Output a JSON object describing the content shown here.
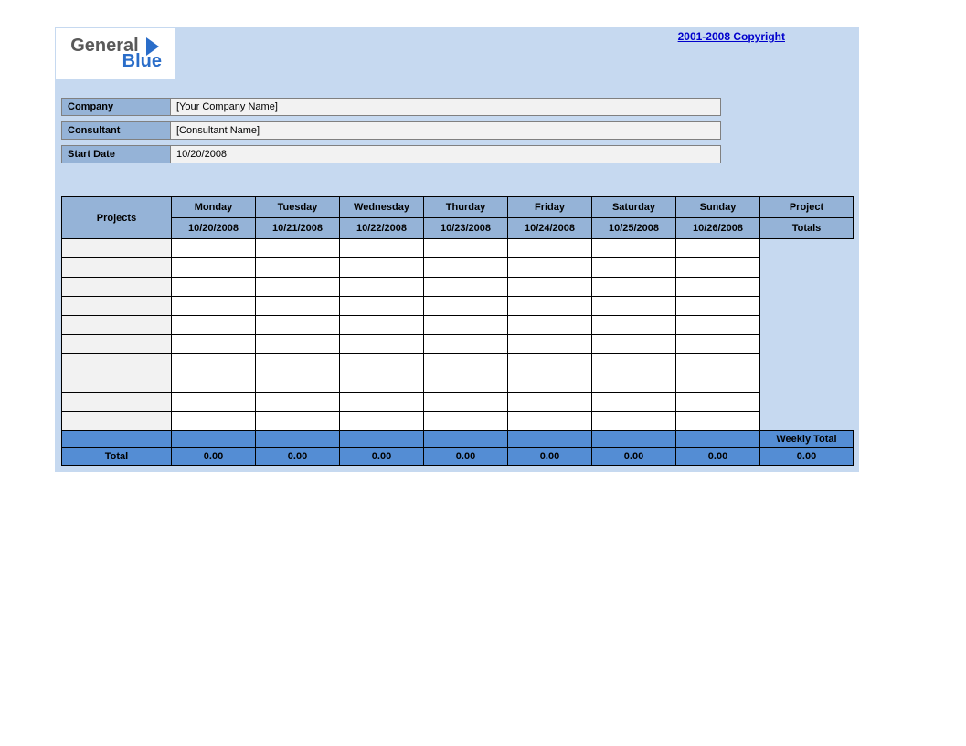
{
  "logo": {
    "line1": "General",
    "line2": "Blue"
  },
  "copyright": "2001-2008 Copyright",
  "info": {
    "company_label": "Company",
    "company_value": "[Your Company Name]",
    "consultant_label": "Consultant",
    "consultant_value": "[Consultant Name]",
    "start_date_label": "Start Date",
    "start_date_value": "10/20/2008"
  },
  "headers": {
    "projects": "Projects",
    "days": [
      {
        "name": "Monday",
        "date": "10/20/2008"
      },
      {
        "name": "Tuesday",
        "date": "10/21/2008"
      },
      {
        "name": "Wednesday",
        "date": "10/22/2008"
      },
      {
        "name": "Thurday",
        "date": "10/23/2008"
      },
      {
        "name": "Friday",
        "date": "10/24/2008"
      },
      {
        "name": "Saturday",
        "date": "10/25/2008"
      },
      {
        "name": "Sunday",
        "date": "10/26/2008"
      }
    ],
    "project_totals_1": "Project",
    "project_totals_2": "Totals"
  },
  "rows": [
    {
      "project": "",
      "cells": [
        "",
        "",
        "",
        "",
        "",
        "",
        ""
      ]
    },
    {
      "project": "",
      "cells": [
        "",
        "",
        "",
        "",
        "",
        "",
        ""
      ]
    },
    {
      "project": "",
      "cells": [
        "",
        "",
        "",
        "",
        "",
        "",
        ""
      ]
    },
    {
      "project": "",
      "cells": [
        "",
        "",
        "",
        "",
        "",
        "",
        ""
      ]
    },
    {
      "project": "",
      "cells": [
        "",
        "",
        "",
        "",
        "",
        "",
        ""
      ]
    },
    {
      "project": "",
      "cells": [
        "",
        "",
        "",
        "",
        "",
        "",
        ""
      ]
    },
    {
      "project": "",
      "cells": [
        "",
        "",
        "",
        "",
        "",
        "",
        ""
      ]
    },
    {
      "project": "",
      "cells": [
        "",
        "",
        "",
        "",
        "",
        "",
        ""
      ]
    },
    {
      "project": "",
      "cells": [
        "",
        "",
        "",
        "",
        "",
        "",
        ""
      ]
    },
    {
      "project": "",
      "cells": [
        "",
        "",
        "",
        "",
        "",
        "",
        ""
      ]
    }
  ],
  "footer": {
    "total_label": "Total",
    "day_totals": [
      "0.00",
      "0.00",
      "0.00",
      "0.00",
      "0.00",
      "0.00",
      "0.00"
    ],
    "weekly_total_label": "Weekly Total",
    "weekly_total_value": "0.00"
  }
}
